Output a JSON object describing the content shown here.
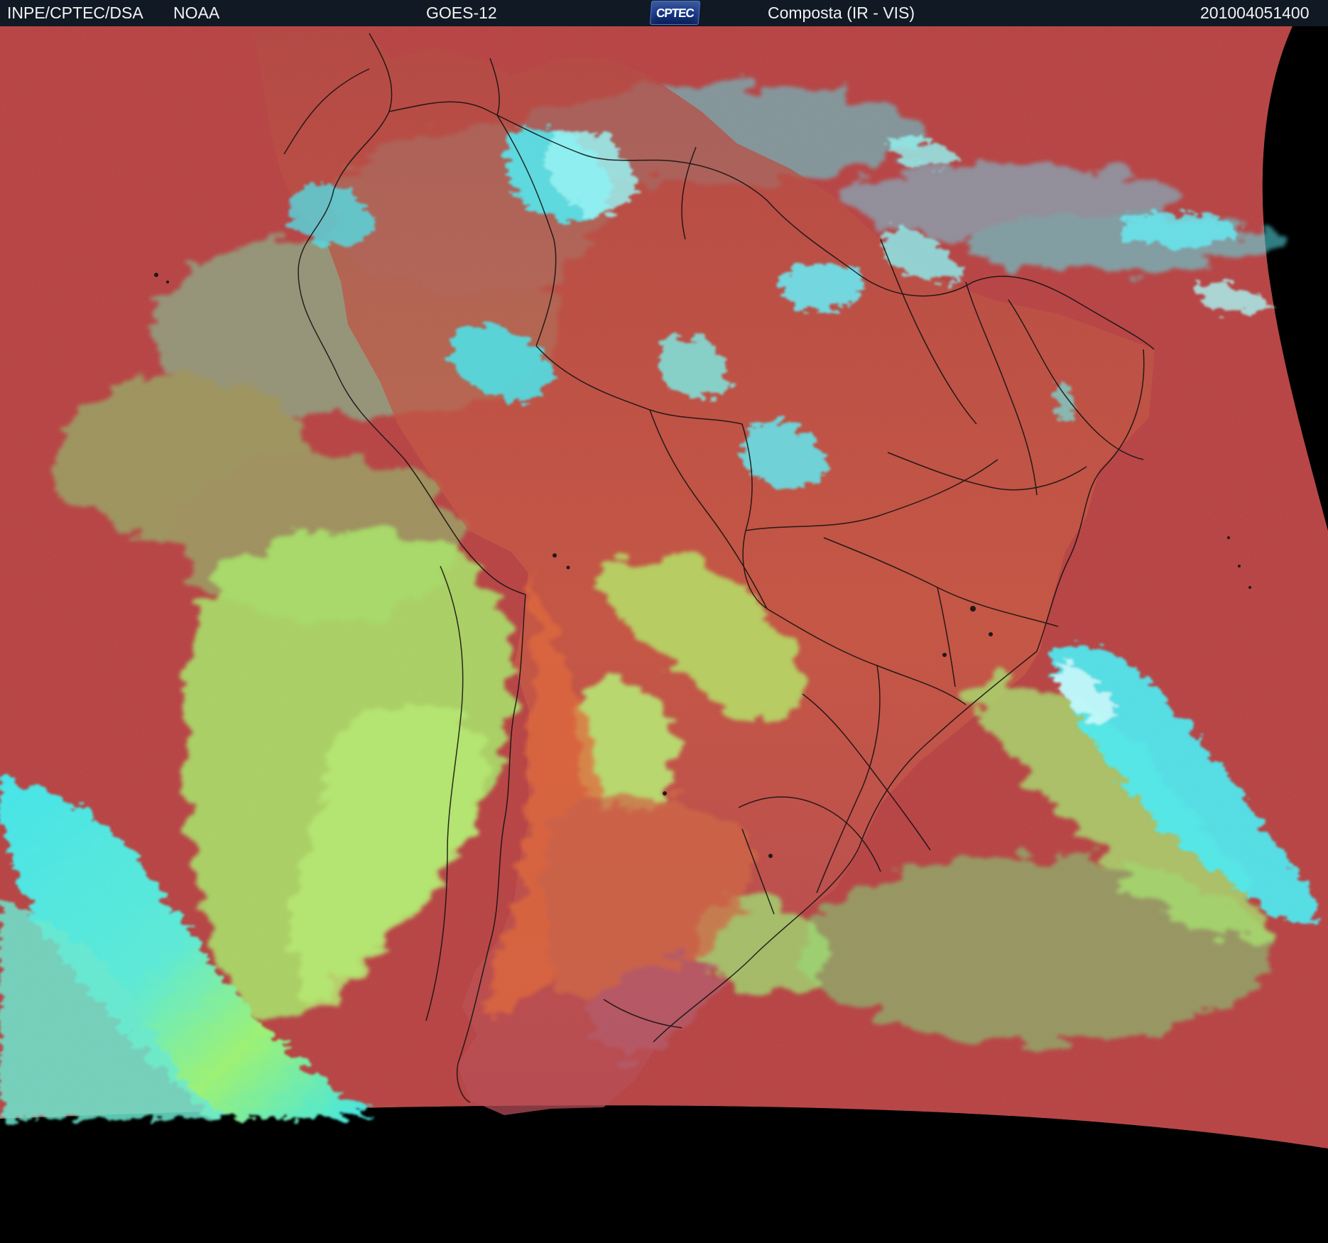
{
  "header": {
    "institution": "INPE/CPTEC/DSA",
    "agency": "NOAA",
    "satellite": "GOES-12",
    "logo_text": "CPTEC",
    "product": "Composta (IR - VIS)",
    "timestamp": "201004051400"
  },
  "map": {
    "region": "South America",
    "style": "false-color composite satellite image",
    "colors": {
      "clear_surface": "#B64A45",
      "land": "#C96845",
      "low_cloud": "#A9E56A",
      "high_cloud": "#49E7F0",
      "background": "#000000",
      "boundaries": "#111111"
    }
  }
}
